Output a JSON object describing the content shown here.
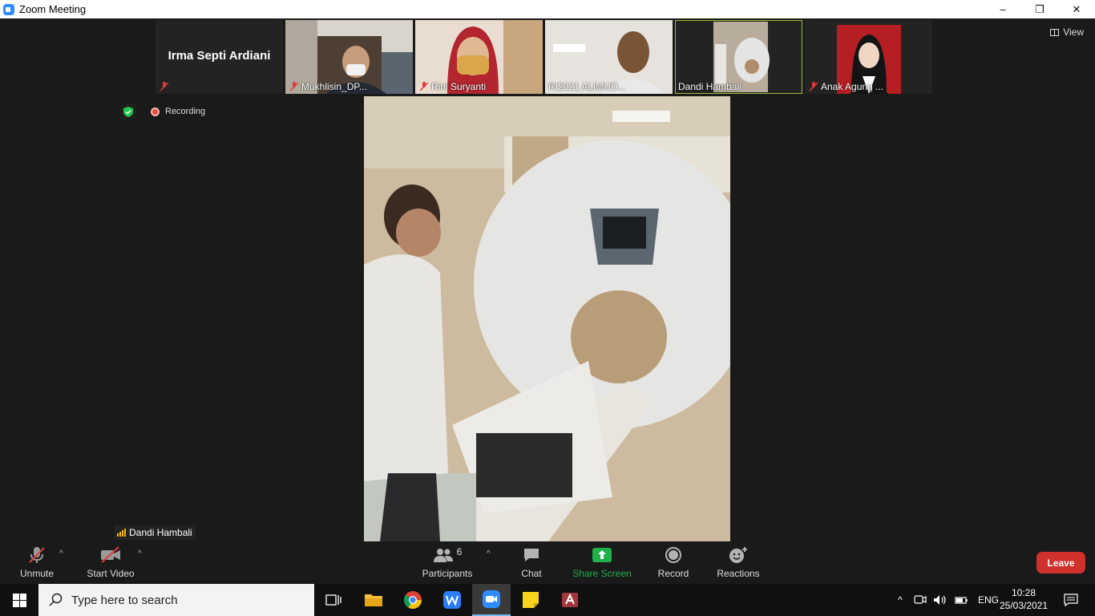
{
  "window": {
    "title": "Zoom Meeting",
    "controls": [
      "–",
      "❐",
      "✕"
    ]
  },
  "thumbnails": [
    {
      "name": "Irma Septi Ardiani",
      "muted": true,
      "type": "text"
    },
    {
      "name": "Mukhlisin_DP...",
      "muted": true,
      "type": "video",
      "bg": "#6b5a4a"
    },
    {
      "name": "Rini Suryanti",
      "muted": true,
      "type": "video",
      "bg": "#b99a78"
    },
    {
      "name": "RI2021 ALIMUD...",
      "muted": false,
      "type": "video",
      "bg": "#cfc8bc"
    },
    {
      "name": "Dandi Hambali",
      "muted": false,
      "type": "video",
      "bg": "#8a8577",
      "active": true
    },
    {
      "name": "Anak Agung ...",
      "muted": true,
      "type": "video",
      "bg": "#b51e22"
    }
  ],
  "view_label": "View",
  "recording_label": "Recording",
  "active_speaker": "Dandi Hambali",
  "toolbar": {
    "unmute": "Unmute",
    "start_video": "Start Video",
    "participants": "Participants",
    "participants_count": "6",
    "chat": "Chat",
    "share_screen": "Share Screen",
    "record": "Record",
    "reactions": "Reactions",
    "leave": "Leave"
  },
  "taskbar": {
    "search_placeholder": "Type here to search",
    "language": "ENG",
    "time": "10:28",
    "date": "25/03/2021"
  },
  "colors": {
    "accent_green": "#1fb14a",
    "leave_red": "#d0312d",
    "active_border": "#9bbf3a"
  }
}
